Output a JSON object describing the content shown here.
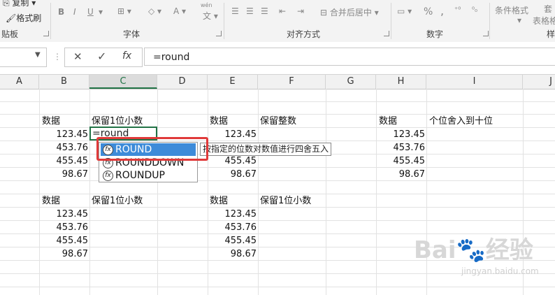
{
  "ribbon": {
    "copy_label": "复制",
    "format_painter_label": "格式刷",
    "clipboard_group": "贴板",
    "font_group": "字体",
    "align_group": "对齐方式",
    "number_group": "数字",
    "styles_group": "样",
    "merge_label": "合并后居中",
    "conditional_format_label": "条件格式",
    "table_label_1": "套",
    "table_label_2": "表格格",
    "bold": "B",
    "italic": "I",
    "underline": "U",
    "font_color": "A",
    "phonetic_top": "wén",
    "phonetic_bottom": "文",
    "percent": "%",
    "comma": ","
  },
  "formula_bar": {
    "name_box": "",
    "cancel_icon": "✕",
    "enter_icon": "✓",
    "fx_label": "fx",
    "formula": "=round"
  },
  "columns": [
    "A",
    "B",
    "C",
    "D",
    "E",
    "F",
    "G",
    "H",
    "I",
    "J"
  ],
  "cells": {
    "b_header1": "数据",
    "c_header1": "保留1位小数",
    "e_header1": "数据",
    "f_header1": "保留整数",
    "h_header1": "数据",
    "i_header1": "个位舍入到十位",
    "b_header2": "数据",
    "c_header2": "保留1位小数",
    "e_header2": "数据",
    "f_header2": "保留1位小数",
    "b_vals1": [
      "123.45",
      "453.76",
      "455.45",
      "98.67"
    ],
    "e_vals1": [
      "123.45",
      "",
      "455.45",
      "98.67"
    ],
    "h_vals1": [
      "123.45",
      "453.76",
      "455.45",
      "98.67"
    ],
    "b_vals2": [
      "123.45",
      "453.76",
      "455.45",
      "98.67"
    ],
    "e_vals2": [
      "123.45",
      "453.76",
      "455.45",
      "98.67"
    ],
    "active_cell_text": "=round"
  },
  "autocomplete": {
    "items": [
      "ROUND",
      "ROUNDDOWN",
      "ROUNDUP"
    ],
    "tooltip": "按指定的位数对数值进行四舍五入"
  },
  "watermark": {
    "brand": "Bai",
    "brand2": "经验",
    "url": "jingyan.baidu.com"
  },
  "colors": {
    "accent": "#217346",
    "selection": "#3d8bd9",
    "highlight_box": "#e03a3a"
  }
}
